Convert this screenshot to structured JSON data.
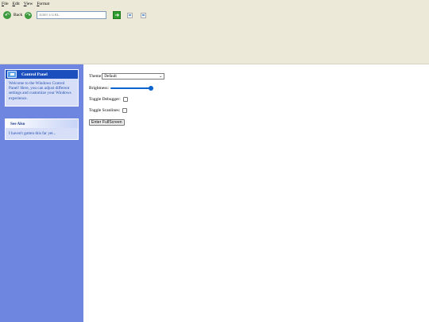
{
  "menu": {
    "items": [
      {
        "first": "F",
        "rest": "ile"
      },
      {
        "first": "E",
        "rest": "dit"
      },
      {
        "first": "V",
        "rest": "iew"
      },
      {
        "first": "F",
        "rest": "ormat"
      }
    ]
  },
  "toolbar": {
    "back_label": "Back",
    "url_placeholder": "Enter a URL",
    "url_value": ""
  },
  "sidebar": {
    "control_panel": {
      "title": "Control Panel",
      "description": "Welcome to the Windows Control Panel! Here, you can adjust different settings and customize your Windows experience."
    },
    "see_also": {
      "title": "See Also",
      "text": "I haven't gotten this far yet..."
    }
  },
  "settings": {
    "theme_label": "Theme",
    "theme_value": "Default",
    "brightness_label": "Brightness:",
    "brightness_value": 1.0,
    "debugger_label": "Toggle Debugger:",
    "debugger_checked": false,
    "scanlines_label": "Toggle Scanlines:",
    "scanlines_checked": false,
    "fullscreen_label": "Enter FullScreen"
  },
  "colors": {
    "chrome": "#ece9d8",
    "sidebar": "#6f86e0",
    "panel_head": "#1b4fbe",
    "accent": "#0b63ce"
  },
  "icons": [
    "back-arrow-icon",
    "forward-arrow-icon",
    "go-arrow-icon",
    "broken-image-icon",
    "control-panel-icon"
  ]
}
